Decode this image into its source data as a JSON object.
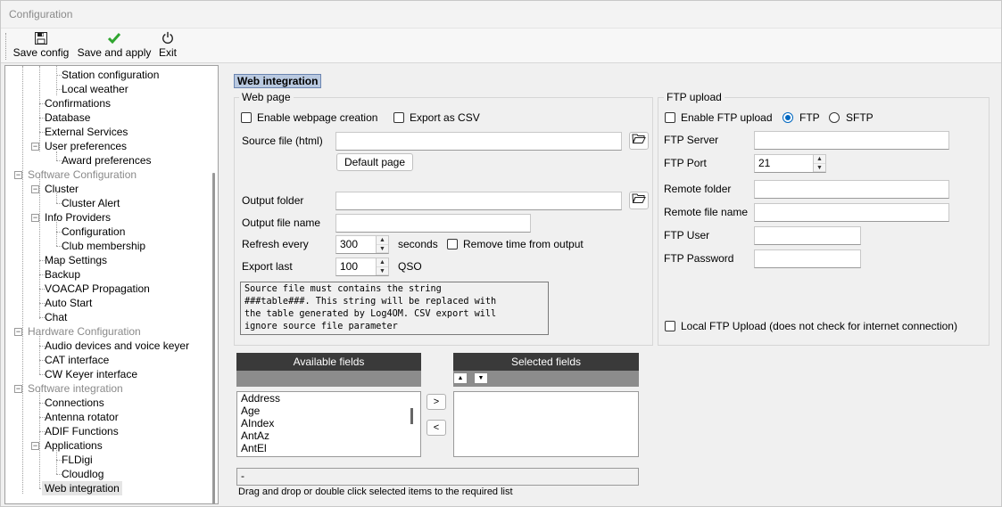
{
  "window": {
    "title": "Configuration"
  },
  "toolbar": {
    "save_config": "Save config",
    "save_apply": "Save and apply",
    "exit": "Exit"
  },
  "tree": {
    "station_configuration": "Station configuration",
    "local_weather": "Local weather",
    "confirmations": "Confirmations",
    "database": "Database",
    "external_services": "External Services",
    "user_preferences": "User preferences",
    "award_preferences": "Award preferences",
    "software_configuration": "Software Configuration",
    "cluster": "Cluster",
    "cluster_alert": "Cluster Alert",
    "info_providers": "Info Providers",
    "configuration": "Configuration",
    "club_membership": "Club membership",
    "map_settings": "Map Settings",
    "backup": "Backup",
    "voacap": "VOACAP Propagation",
    "auto_start": "Auto Start",
    "chat": "Chat",
    "hardware_configuration": "Hardware Configuration",
    "audio_devices": "Audio devices and voice keyer",
    "cat_interface": "CAT interface",
    "cw_keyer": "CW Keyer interface",
    "software_integration": "Software integration",
    "connections": "Connections",
    "antenna_rotator": "Antenna rotator",
    "adif_functions": "ADIF Functions",
    "applications": "Applications",
    "fldigi": "FLDigi",
    "cloudlog": "Cloudlog",
    "web_integration": "Web integration"
  },
  "header": "Web integration",
  "web_page": {
    "title": "Web page",
    "enable_label": "Enable webpage creation",
    "export_csv_label": "Export as CSV",
    "source_label": "Source file (html)",
    "source_value": "",
    "default_page": "Default page",
    "output_folder_label": "Output folder",
    "output_folder_value": "",
    "output_name_label": "Output file name",
    "output_name_value": "",
    "refresh_label": "Refresh every",
    "refresh_value": "300",
    "seconds": "seconds",
    "remove_time_label": "Remove time from output",
    "export_last_label": "Export last",
    "export_last_value": "100",
    "qso": "QSO",
    "note": "Source file must contains the string\n###table###. This string will be replaced with\nthe table generated by Log4OM. CSV export will\nignore source file parameter"
  },
  "ftp": {
    "title": "FTP upload",
    "enable_label": "Enable FTP upload",
    "ftp_label": "FTP",
    "sftp_label": "SFTP",
    "server_label": "FTP Server",
    "server_value": "",
    "port_label": "FTP Port",
    "port_value": "21",
    "remote_folder_label": "Remote folder",
    "remote_folder_value": "",
    "remote_file_label": "Remote file name",
    "remote_file_value": "",
    "user_label": "FTP User",
    "user_value": "",
    "password_label": "FTP Password",
    "password_value": "",
    "local_upload_label": "Local FTP Upload (does not check for internet connection)"
  },
  "fields": {
    "available_title": "Available fields",
    "selected_title": "Selected fields",
    "available": [
      "Address",
      "Age",
      "AIndex",
      "AntAz",
      "AntEl"
    ],
    "add": ">",
    "remove": "<",
    "status_value": "-",
    "hint": "Drag and drop or double click selected items to the required list"
  }
}
